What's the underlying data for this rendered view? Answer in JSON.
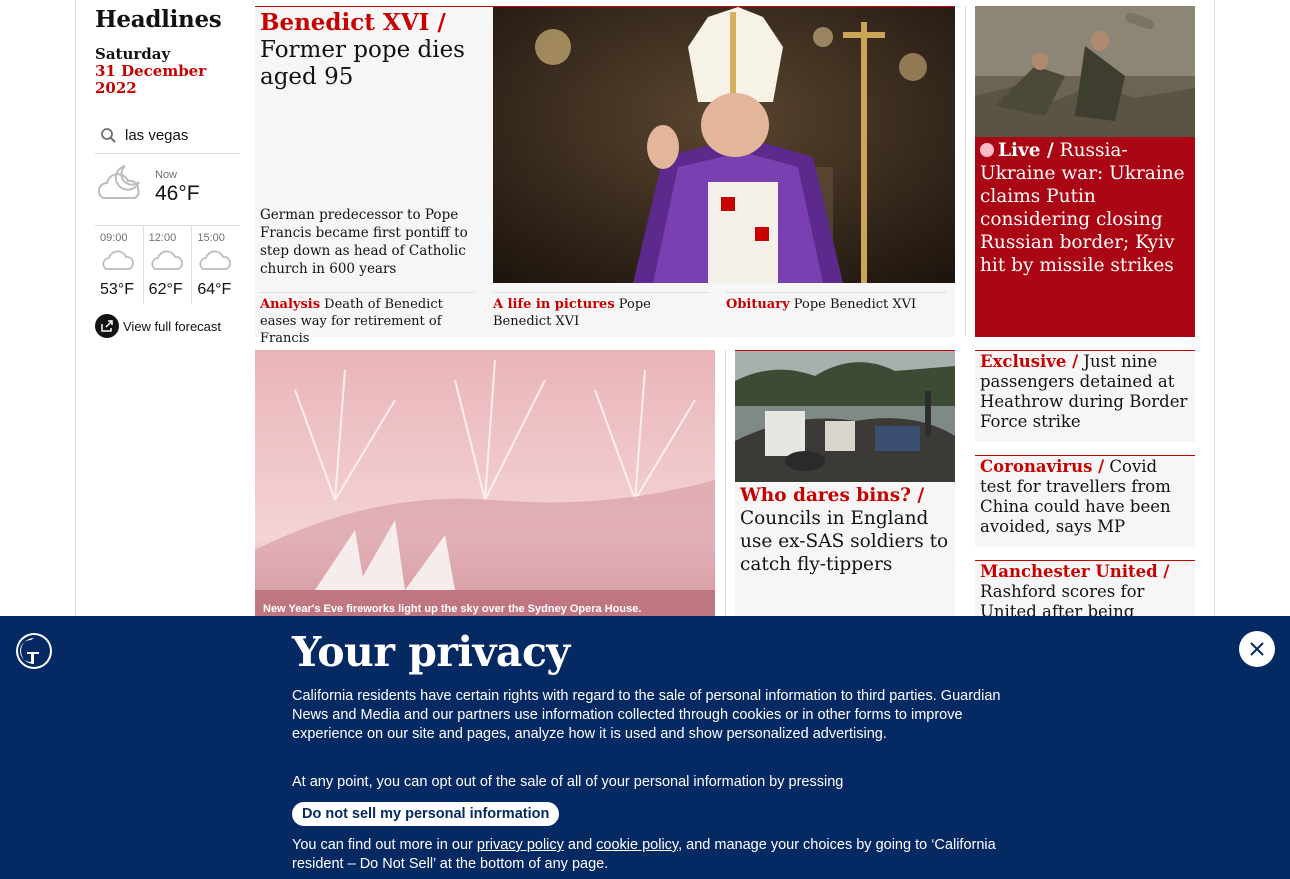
{
  "headlines": {
    "title": "Headlines",
    "day": "Saturday",
    "date": "31 December 2022"
  },
  "weather": {
    "location": "las vegas",
    "now_label": "Now",
    "now_temp": "46°F",
    "forecast": [
      {
        "time": "09:00",
        "temp": "53°F"
      },
      {
        "time": "12:00",
        "temp": "62°F"
      },
      {
        "time": "15:00",
        "temp": "64°F"
      }
    ],
    "full_forecast_label": "View full forecast"
  },
  "lead": {
    "kicker": "Benedict XVI /",
    "headline": "Former pope dies aged 95",
    "standfirst": "German predecessor to Pope Francis became first pontiff to step down as head of Catholic church in 600 years",
    "sublinks": [
      {
        "kicker": "Analysis",
        "text": "Death of Benedict eases way for retirement of Francis"
      },
      {
        "kicker": "A life in pictures",
        "text": "Pope Benedict XVI"
      },
      {
        "kicker": "Obituary",
        "text": "Pope Benedict XVI"
      }
    ]
  },
  "live": {
    "kicker": "Live /",
    "headline": "Russia-Ukraine war: Ukraine claims Putin considering closing Russian border; Kyiv hit by missile strikes"
  },
  "fireworks": {
    "caption": "New Year's Eve fireworks light up the sky over the Sydney Opera House."
  },
  "bins": {
    "kicker": "Who dares bins? /",
    "headline": "Councils in England use ex-SAS soldiers to catch fly-tippers"
  },
  "right_cards": [
    {
      "kicker": "Exclusive /",
      "headline": "Just nine passengers detained at Heathrow during Border Force strike"
    },
    {
      "kicker": "Coronavirus /",
      "headline": "Covid test for travellers from China could have been avoided, says MP"
    },
    {
      "kicker": "Manchester United /",
      "headline": "Rashford scores for United after being dropped over"
    }
  ],
  "privacy": {
    "title": "Your privacy",
    "para1": "California residents have certain rights with regard to the sale of personal information to third parties. Guardian News and Media and our partners use information collected through cookies or in other forms to improve experience on our site and pages, analyze how it is used and show personalized advertising.",
    "para2": "At any point, you can opt out of the sale of all of your personal information by pressing",
    "button": "Do not sell my personal information",
    "para3_a": "You can find out more in our ",
    "privacy_policy": "privacy policy",
    "para3_and": " and ",
    "cookie_policy": "cookie policy",
    "para3_b": ", and manage your choices by going to ‘California resident – Do Not Sell’ at the bottom of any page."
  },
  "colors": {
    "accent_red": "#c70000",
    "live_bg": "#ab0613",
    "privacy_bg": "#052962"
  }
}
